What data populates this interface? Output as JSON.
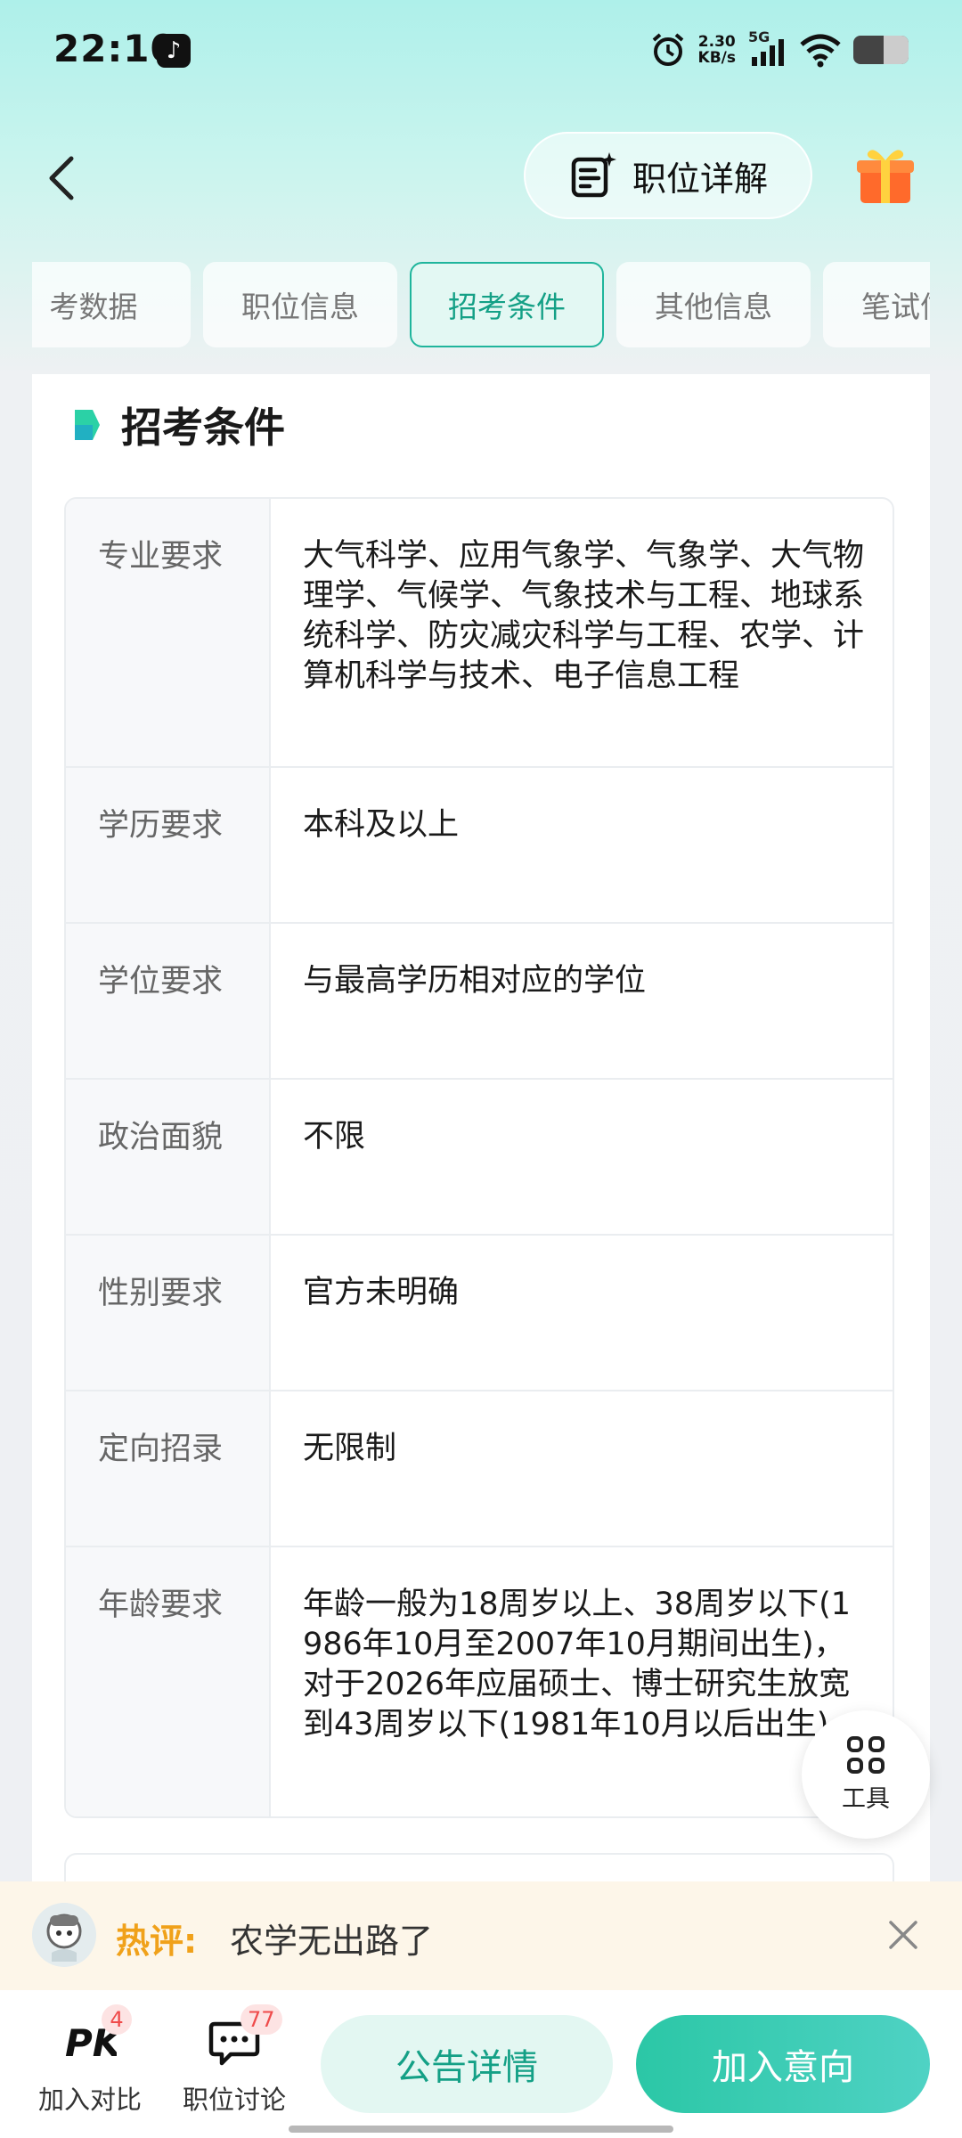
{
  "status_bar": {
    "time": "22:10",
    "speed_value": "2.30",
    "speed_unit": "KB/s",
    "network": "5G",
    "icons": [
      "tiktok-icon",
      "alarm-icon",
      "signal-icon",
      "wifi-icon",
      "battery-icon"
    ]
  },
  "header": {
    "detail_label": "职位详解",
    "icons": [
      "back-icon",
      "document-sparkle-icon",
      "gift-icon"
    ]
  },
  "tabs": [
    {
      "label": "考数据",
      "active": false
    },
    {
      "label": "职位信息",
      "active": false
    },
    {
      "label": "招考条件",
      "active": true
    },
    {
      "label": "其他信息",
      "active": false
    },
    {
      "label": "笔试信息",
      "active": false
    }
  ],
  "section": {
    "title": "招考条件"
  },
  "conditions": [
    {
      "key": "专业要求",
      "value": "大气科学、应用气象学、气象学、大气物理学、气候学、气象技术与工程、地球系统科学、防灾减灾科学与工程、农学、计算机科学与技术、电子信息工程"
    },
    {
      "key": "学历要求",
      "value": "本科及以上"
    },
    {
      "key": "学位要求",
      "value": "与最高学历相对应的学位"
    },
    {
      "key": "政治面貌",
      "value": "不限"
    },
    {
      "key": "性别要求",
      "value": "官方未明确"
    },
    {
      "key": "定向招录",
      "value": "无限制"
    },
    {
      "key": "年龄要求",
      "value": "年龄一般为18周岁以上、38周岁以下(1986年10月至2007年10月期间出生)，对于2026年应届硕士、博士研究生放宽到43周岁以下(1981年10月以后出生)"
    }
  ],
  "tools": {
    "label": "工具"
  },
  "hot_comment": {
    "label": "热评:",
    "text": "农学无出路了"
  },
  "bottom": {
    "compare_label": "加入对比",
    "compare_badge": "4",
    "discuss_label": "职位讨论",
    "discuss_badge": "77",
    "notice_button": "公告详情",
    "join_button": "加入意向"
  },
  "colors": {
    "accent": "#14a086",
    "accent_bg": "#e3f8f3",
    "hot_label": "#f0a11a",
    "badge": "#ef4b4b"
  }
}
